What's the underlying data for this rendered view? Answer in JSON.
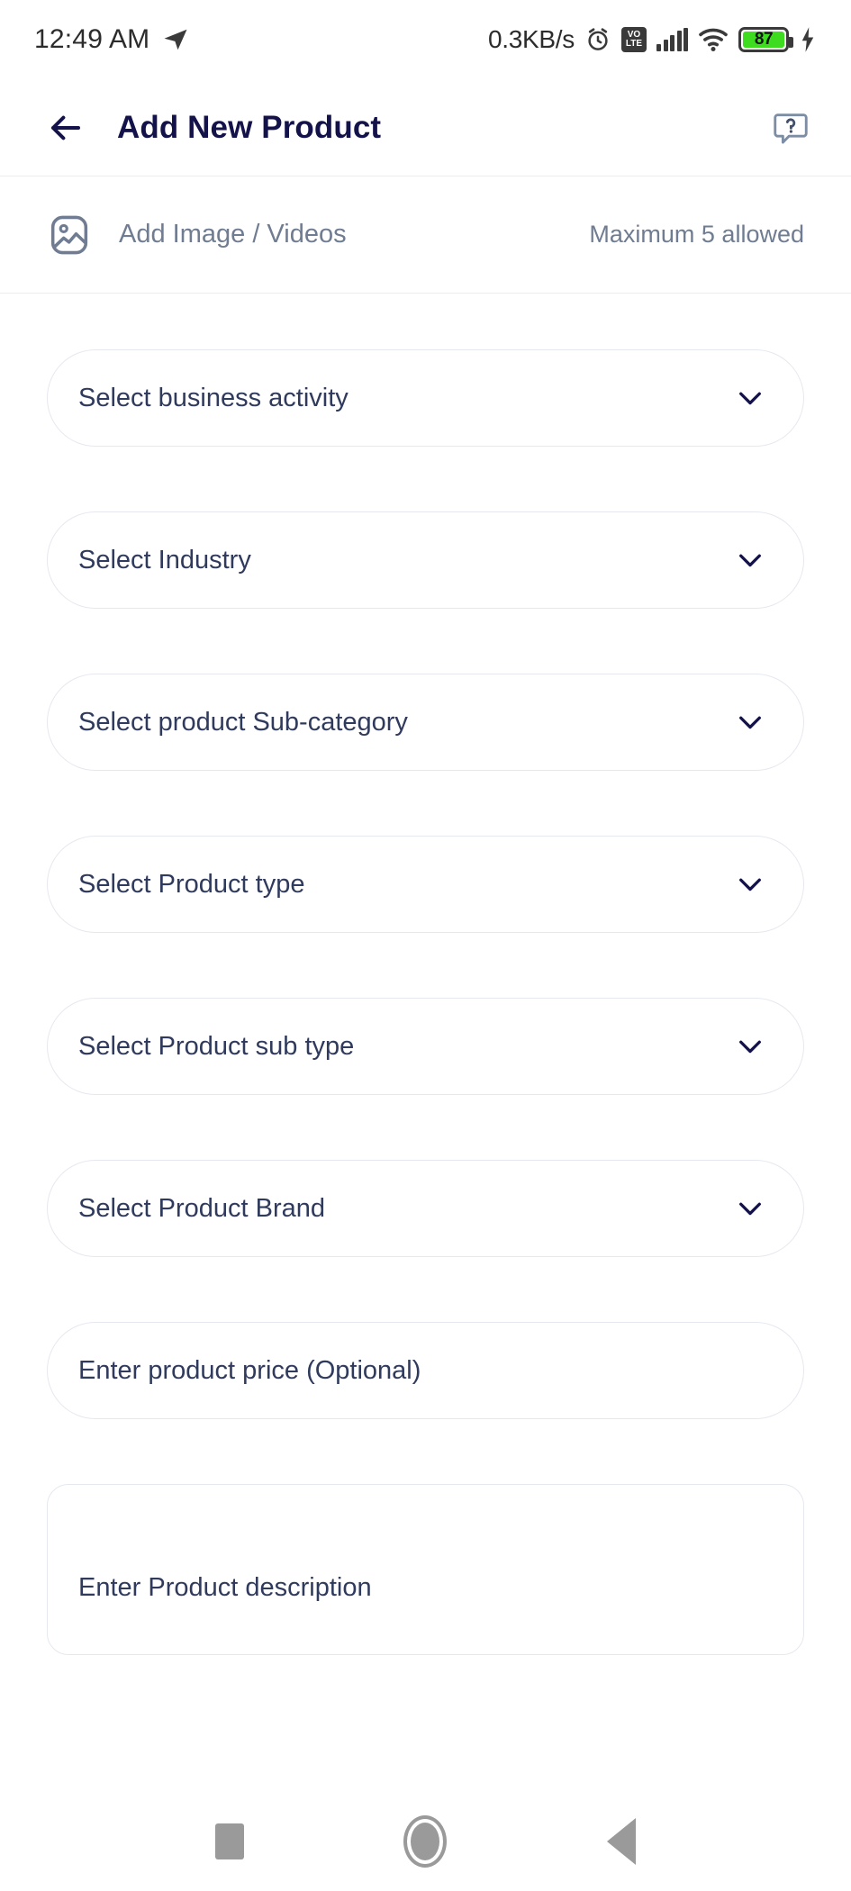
{
  "status_bar": {
    "time": "12:49 AM",
    "send_icon": "telegram-send-icon",
    "network_speed": "0.3KB/s",
    "alarm_icon": "alarm-clock-icon",
    "volte_top": "VO",
    "volte_bottom": "LTE",
    "signal_icon": "cellular-signal-icon",
    "wifi_icon": "wifi-icon",
    "battery_percent": "87",
    "charging_icon": "lightning-bolt-icon",
    "battery_color": "#3ddc1f"
  },
  "app_bar": {
    "back_icon": "arrow-left-icon",
    "title": "Add New Product",
    "help_icon": "help-chat-bubble-icon",
    "title_color": "#14124a"
  },
  "media_row": {
    "image_icon": "image-placeholder-icon",
    "label": "Add Image / Videos",
    "max_note": "Maximum 5 allowed",
    "text_color": "#6f7c91"
  },
  "form": {
    "chevron_icon": "chevron-down-icon",
    "fields": [
      {
        "label": "Select business activity",
        "type": "dropdown"
      },
      {
        "label": "Select Industry",
        "type": "dropdown"
      },
      {
        "label": "Select product Sub-category",
        "type": "dropdown"
      },
      {
        "label": "Select Product type",
        "type": "dropdown"
      },
      {
        "label": "Select Product sub type",
        "type": "dropdown"
      },
      {
        "label": "Select Product Brand",
        "type": "dropdown"
      },
      {
        "label": "Enter product price (Optional)",
        "type": "text"
      }
    ],
    "description": {
      "label": "Enter Product description",
      "type": "textarea"
    }
  },
  "nav_bar": {
    "recents_icon": "square-recents-icon",
    "home_icon": "circle-home-icon",
    "back_icon": "triangle-back-icon"
  }
}
